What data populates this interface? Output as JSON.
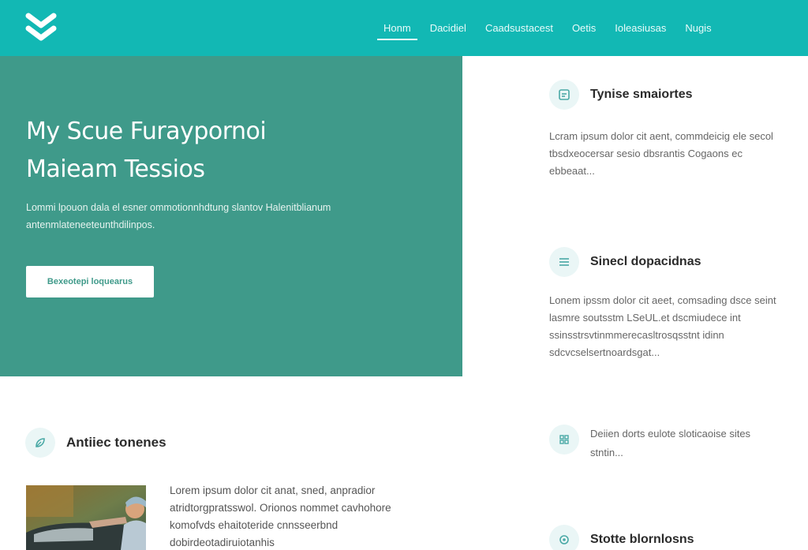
{
  "brand": {
    "logo_icon": "double-chevron-down-icon",
    "header_color": "#12b8b4"
  },
  "nav": {
    "items": [
      {
        "label": "Honm",
        "active": true
      },
      {
        "label": "Dacidiel",
        "active": false
      },
      {
        "label": "Caadsustacest",
        "active": false
      },
      {
        "label": "Oetis",
        "active": false
      },
      {
        "label": "Ioleasiusas",
        "active": false
      },
      {
        "label": "Nugis",
        "active": false
      }
    ]
  },
  "hero": {
    "title_line1": "My Scue Furaypornoi",
    "title_line2": "Maieam Tessios",
    "text": "Lommi lpouon dala el esner ommotionnhdtung slantov Halenitblianum antenmlateneeteunthdilinpos.",
    "button_label": "Bexeotepi loquearus",
    "bg_color": "#3f9a8a"
  },
  "features": [
    {
      "icon": "badge-icon",
      "title": "Tynise smaiortes",
      "text": "Lcram ipsum dolor cit aent, commdeicig ele secol tbsdxeocersar sesio dbsrantis Cogaons ec ebbeaat..."
    },
    {
      "icon": "stack-icon",
      "title": "Sinecl dopacidnas",
      "text": "Lonem ipssm dolor cit aeet, comsading dsce seint lasmre soutsstm LSeUL.et dscmiudece int ssinsstrsvtinmmerecasltrosqsstnt idinn sdcvcselsertnoardsgat..."
    },
    {
      "icon": "grid-icon",
      "title": "",
      "text": "Deiien dorts eulote sloticaoise sites stntin..."
    },
    {
      "icon": "gear-icon",
      "title": "Stotte blornlosns",
      "text": ""
    }
  ],
  "articles": {
    "icon": "leaf-icon",
    "title": "Antiiec tonenes",
    "photo_label": "woman-car-photo",
    "text": "Lorem ipsum dolor cit anat, sned, anpradior atridtorgpratsswol. Orionos nommet cavhohore komofvds ehaitoteride cnnsseerbnd dobirdeotadiruiotanhis"
  }
}
